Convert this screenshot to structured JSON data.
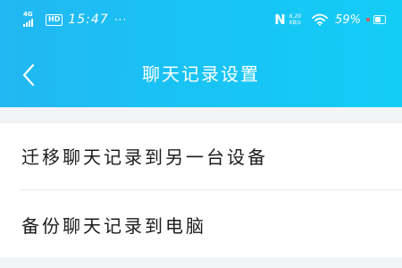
{
  "status_bar": {
    "network": "4G",
    "hd": "HD",
    "time": "15:47",
    "more": "···",
    "nfc": "N",
    "net_speed_value": "6.20",
    "net_speed_unit": "KB/s",
    "battery_percent": "59%",
    "battery_level": 0.59
  },
  "header": {
    "title": "聊天记录设置"
  },
  "menu": {
    "items": [
      {
        "label": "迁移聊天记录到另一台设备"
      },
      {
        "label": "备份聊天记录到电脑"
      }
    ]
  },
  "colors": {
    "header_start": "#22b7f2",
    "header_end": "#13ccf6",
    "background_band": "#f2f3f5",
    "text": "#1c1c1c"
  }
}
